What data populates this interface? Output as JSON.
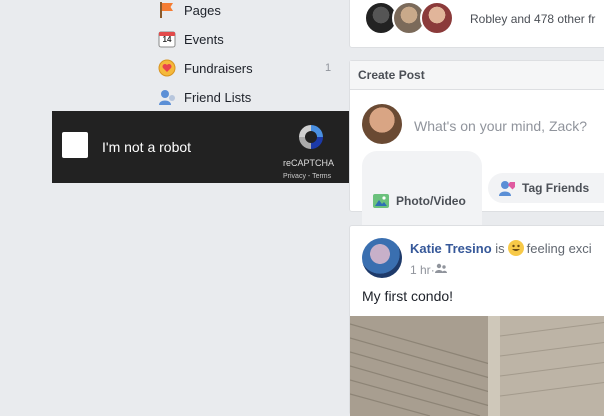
{
  "sidebar": {
    "items": [
      {
        "label": "Pages",
        "icon": "flag-icon",
        "count": ""
      },
      {
        "label": "Events",
        "icon": "calendar-icon",
        "day": "14",
        "count": ""
      },
      {
        "label": "Fundraisers",
        "icon": "heart-coin-icon",
        "count": "1"
      },
      {
        "label": "Friend Lists",
        "icon": "friends-icon",
        "count": ""
      }
    ]
  },
  "captcha": {
    "label": "I'm not a robot",
    "brand": "reCAPTCHA",
    "privacy": "Privacy",
    "separator": " - ",
    "terms": "Terms"
  },
  "top_card": {
    "likers_text": "Robley and 478 other fr"
  },
  "create_post": {
    "title": "Create Post",
    "placeholder": "What's on your mind, Zack?",
    "photo_video_label": "Photo/Video",
    "tag_friends_label": "Tag Friends"
  },
  "post": {
    "author": "Katie Tresino",
    "is": "is",
    "feeling": "feeling exci",
    "time": "1 hr",
    "dot": " · ",
    "text": "My first condo!"
  },
  "colors": {
    "background": "#e9ebee",
    "link": "#365899",
    "captcha_bg": "#222222"
  }
}
